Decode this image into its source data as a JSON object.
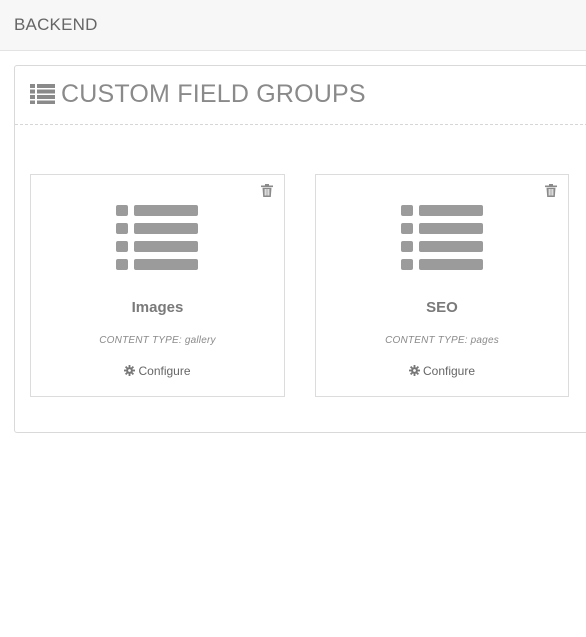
{
  "topbar": {
    "title": "BACKEND"
  },
  "panel": {
    "heading": "CUSTOM FIELD GROUPS",
    "heading_icon": "list-icon"
  },
  "cards": [
    {
      "name": "Images",
      "content_type": "CONTENT TYPE: gallery",
      "configure_label": "Configure",
      "icon": "list-icon",
      "delete_icon": "trash-icon"
    },
    {
      "name": "SEO",
      "content_type": "CONTENT TYPE: pages",
      "configure_label": "Configure",
      "icon": "list-icon",
      "delete_icon": "trash-icon"
    }
  ],
  "colors": {
    "icon_gray": "#9b9b9b",
    "topbar_bg": "#f7f7f7"
  }
}
